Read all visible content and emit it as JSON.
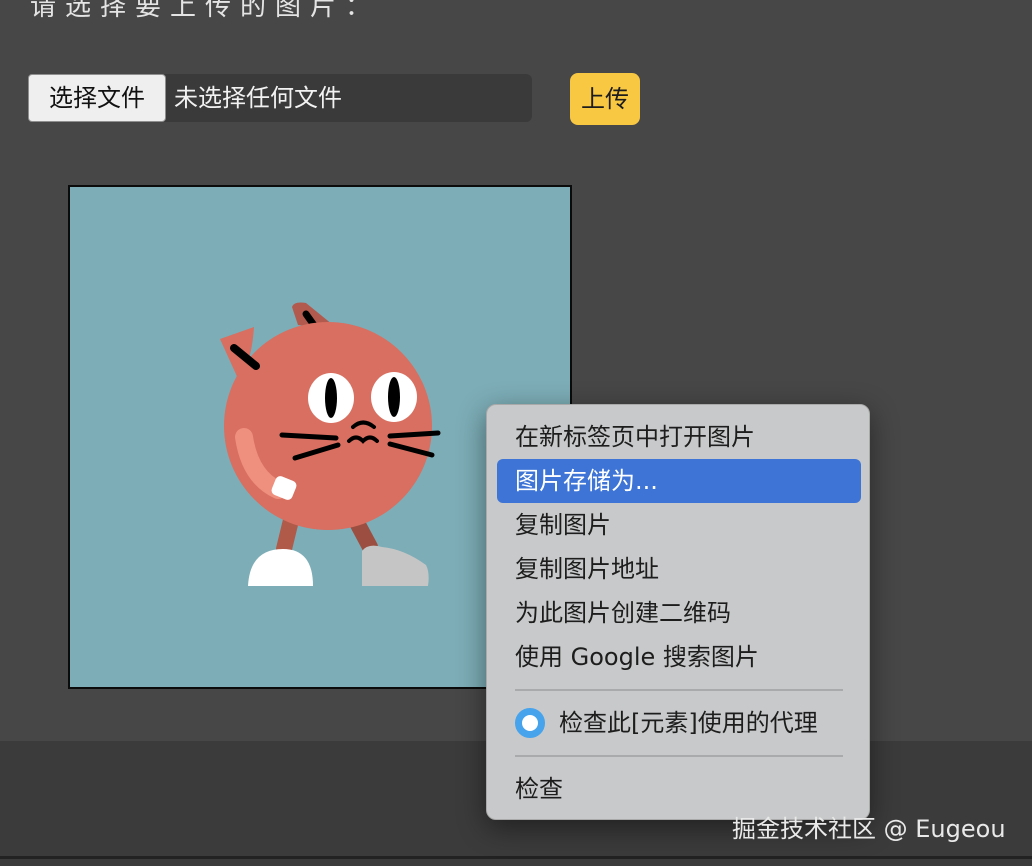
{
  "page": {
    "prompt": "请选择要上传的图片："
  },
  "upload_form": {
    "choose_file_label": "选择文件",
    "file_status": "未选择任何文件",
    "upload_label": "上传"
  },
  "context_menu": {
    "items": [
      {
        "label": "在新标签页中打开图片"
      },
      {
        "label": "图片存储为..."
      },
      {
        "label": "复制图片"
      },
      {
        "label": "复制图片地址"
      },
      {
        "label": "为此图片创建二维码"
      },
      {
        "label": "使用 Google 搜索图片"
      },
      {
        "label": "检查此[元素]使用的代理"
      },
      {
        "label": "检查"
      }
    ],
    "active_item": "图片存储为..."
  },
  "watermark": "掘金技术社区 @ Eugeou",
  "colors": {
    "page_bg": "#474747",
    "upload_button": "#f9c843",
    "image_bg": "#7dadb7",
    "cat_body": "#d86f60",
    "menu_bg": "#c8c9ca",
    "menu_highlight": "#3d74d6",
    "extension_icon": "#46a3ec"
  },
  "icons": {
    "extension": "proxy-extension-icon"
  }
}
